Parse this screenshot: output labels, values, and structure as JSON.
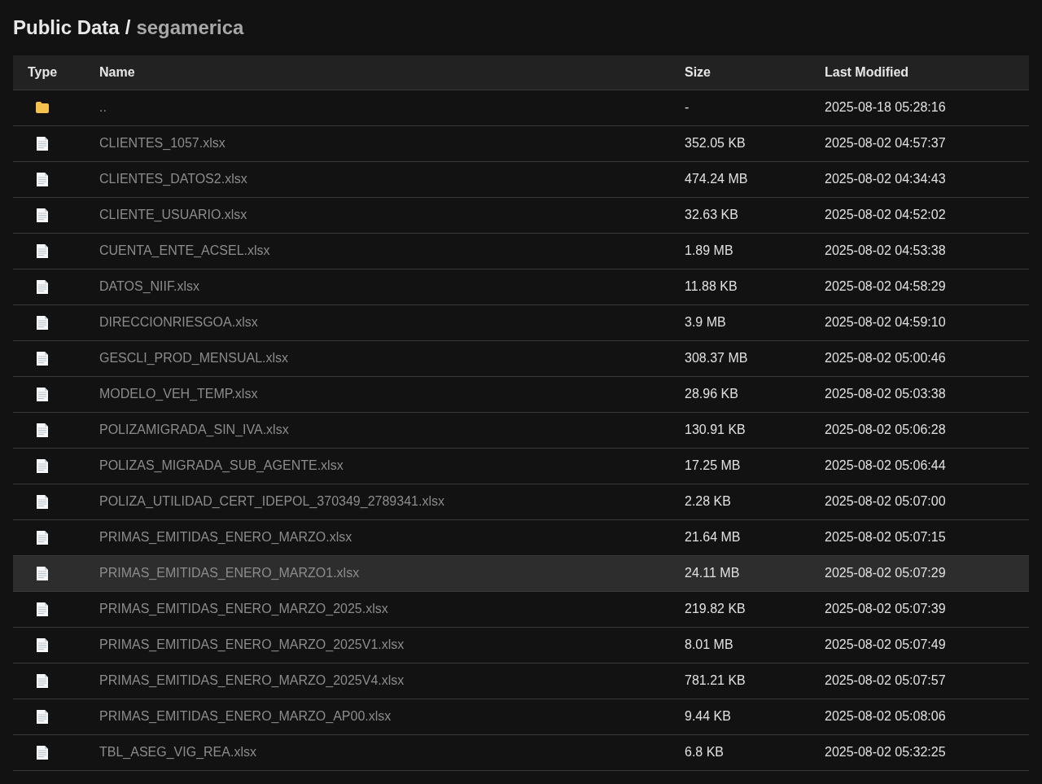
{
  "title": {
    "root": "Public Data",
    "separator": "/",
    "current": "segamerica"
  },
  "table": {
    "columns": [
      "Type",
      "Name",
      "Size",
      "Last Modified"
    ],
    "rows": [
      {
        "kind": "folder",
        "name": "..",
        "size": "-",
        "modified": "2025-08-18 05:28:16",
        "highlighted": false
      },
      {
        "kind": "file",
        "name": "CLIENTES_1057.xlsx",
        "size": "352.05 KB",
        "modified": "2025-08-02 04:57:37",
        "highlighted": false
      },
      {
        "kind": "file",
        "name": "CLIENTES_DATOS2.xlsx",
        "size": "474.24 MB",
        "modified": "2025-08-02 04:34:43",
        "highlighted": false
      },
      {
        "kind": "file",
        "name": "CLIENTE_USUARIO.xlsx",
        "size": "32.63 KB",
        "modified": "2025-08-02 04:52:02",
        "highlighted": false
      },
      {
        "kind": "file",
        "name": "CUENTA_ENTE_ACSEL.xlsx",
        "size": "1.89 MB",
        "modified": "2025-08-02 04:53:38",
        "highlighted": false
      },
      {
        "kind": "file",
        "name": "DATOS_NIIF.xlsx",
        "size": "11.88 KB",
        "modified": "2025-08-02 04:58:29",
        "highlighted": false
      },
      {
        "kind": "file",
        "name": "DIRECCIONRIESGOA.xlsx",
        "size": "3.9 MB",
        "modified": "2025-08-02 04:59:10",
        "highlighted": false
      },
      {
        "kind": "file",
        "name": "GESCLI_PROD_MENSUAL.xlsx",
        "size": "308.37 MB",
        "modified": "2025-08-02 05:00:46",
        "highlighted": false
      },
      {
        "kind": "file",
        "name": "MODELO_VEH_TEMP.xlsx",
        "size": "28.96 KB",
        "modified": "2025-08-02 05:03:38",
        "highlighted": false
      },
      {
        "kind": "file",
        "name": "POLIZAMIGRADA_SIN_IVA.xlsx",
        "size": "130.91 KB",
        "modified": "2025-08-02 05:06:28",
        "highlighted": false
      },
      {
        "kind": "file",
        "name": "POLIZAS_MIGRADA_SUB_AGENTE.xlsx",
        "size": "17.25 MB",
        "modified": "2025-08-02 05:06:44",
        "highlighted": false
      },
      {
        "kind": "file",
        "name": "POLIZA_UTILIDAD_CERT_IDEPOL_370349_2789341.xlsx",
        "size": "2.28 KB",
        "modified": "2025-08-02 05:07:00",
        "highlighted": false
      },
      {
        "kind": "file",
        "name": "PRIMAS_EMITIDAS_ENERO_MARZO.xlsx",
        "size": "21.64 MB",
        "modified": "2025-08-02 05:07:15",
        "highlighted": false
      },
      {
        "kind": "file",
        "name": "PRIMAS_EMITIDAS_ENERO_MARZO1.xlsx",
        "size": "24.11 MB",
        "modified": "2025-08-02 05:07:29",
        "highlighted": true
      },
      {
        "kind": "file",
        "name": "PRIMAS_EMITIDAS_ENERO_MARZO_2025.xlsx",
        "size": "219.82 KB",
        "modified": "2025-08-02 05:07:39",
        "highlighted": false
      },
      {
        "kind": "file",
        "name": "PRIMAS_EMITIDAS_ENERO_MARZO_2025V1.xlsx",
        "size": "8.01 MB",
        "modified": "2025-08-02 05:07:49",
        "highlighted": false
      },
      {
        "kind": "file",
        "name": "PRIMAS_EMITIDAS_ENERO_MARZO_2025V4.xlsx",
        "size": "781.21 KB",
        "modified": "2025-08-02 05:07:57",
        "highlighted": false
      },
      {
        "kind": "file",
        "name": "PRIMAS_EMITIDAS_ENERO_MARZO_AP00.xlsx",
        "size": "9.44 KB",
        "modified": "2025-08-02 05:08:06",
        "highlighted": false
      },
      {
        "kind": "file",
        "name": "TBL_ASEG_VIG_REA.xlsx",
        "size": "6.8 KB",
        "modified": "2025-08-02 05:32:25",
        "highlighted": false
      }
    ]
  }
}
